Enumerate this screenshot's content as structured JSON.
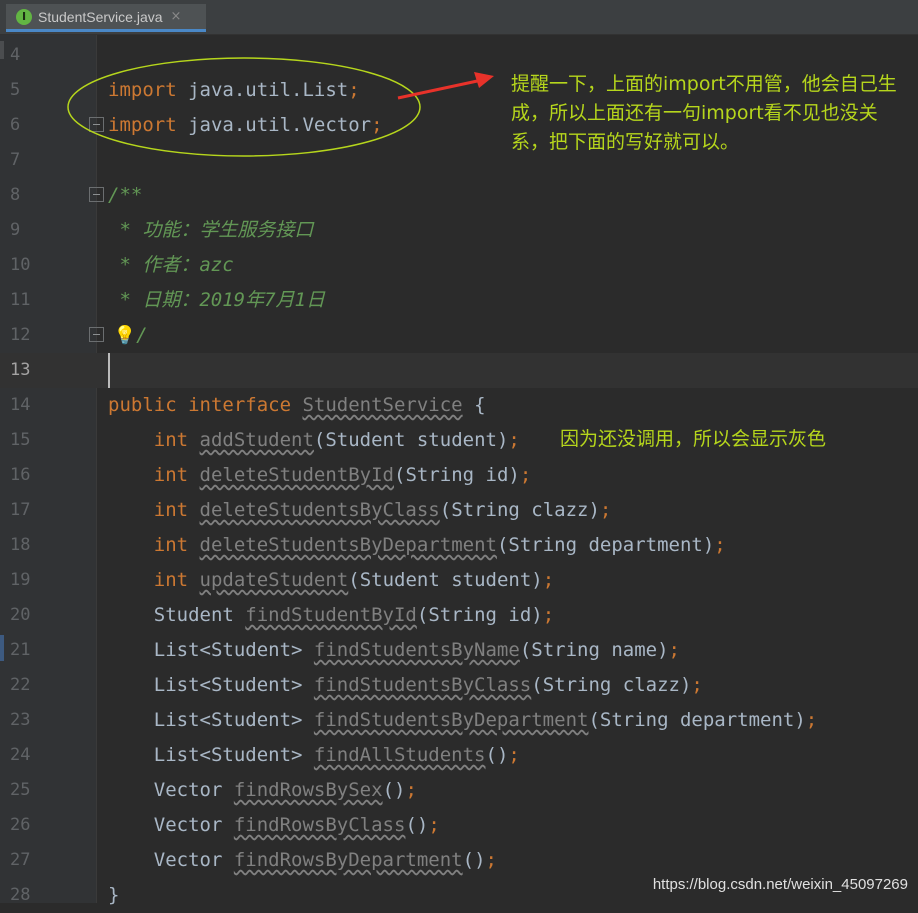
{
  "tab": {
    "filename": "StudentService.java",
    "icon": "I",
    "close": "×"
  },
  "editor": {
    "lines": [
      {
        "num": "4",
        "segments": []
      },
      {
        "num": "5",
        "segments": [
          {
            "cls": "kw",
            "text": "import "
          },
          {
            "cls": "plain",
            "text": "java.util.List"
          },
          {
            "cls": "kw",
            "text": ";"
          }
        ]
      },
      {
        "num": "6",
        "fold": true,
        "segments": [
          {
            "cls": "kw",
            "text": "import "
          },
          {
            "cls": "plain",
            "text": "java.util.Vector"
          },
          {
            "cls": "kw",
            "text": ";"
          }
        ]
      },
      {
        "num": "7",
        "segments": []
      },
      {
        "num": "8",
        "fold": true,
        "segments": [
          {
            "cls": "cmt",
            "text": "/**"
          }
        ]
      },
      {
        "num": "9",
        "segments": [
          {
            "cls": "cmt",
            "text": " * 功能：学生服务接口"
          }
        ]
      },
      {
        "num": "10",
        "segments": [
          {
            "cls": "cmt",
            "text": " * 作者：azc"
          }
        ]
      },
      {
        "num": "11",
        "segments": [
          {
            "cls": "cmt",
            "text": " * 日期：2019年7月1日"
          }
        ]
      },
      {
        "num": "12",
        "fold": true,
        "segments": [
          {
            "cls": "cmt bulb",
            "text": " 💡"
          },
          {
            "cls": "cmt",
            "text": "/"
          }
        ]
      },
      {
        "num": "13",
        "current": true,
        "segments": []
      },
      {
        "num": "14",
        "segments": [
          {
            "cls": "kw",
            "text": "public interface "
          },
          {
            "cls": "unused",
            "text": "StudentService"
          },
          {
            "cls": "plain",
            "text": " {"
          }
        ]
      },
      {
        "num": "15",
        "segments": [
          {
            "cls": "plain",
            "text": "    "
          },
          {
            "cls": "kw",
            "text": "int "
          },
          {
            "cls": "unused",
            "text": "addStudent"
          },
          {
            "cls": "plain",
            "text": "(Student student)"
          },
          {
            "cls": "kw",
            "text": ";"
          }
        ]
      },
      {
        "num": "16",
        "segments": [
          {
            "cls": "plain",
            "text": "    "
          },
          {
            "cls": "kw",
            "text": "int "
          },
          {
            "cls": "unused",
            "text": "deleteStudentById"
          },
          {
            "cls": "plain",
            "text": "(String id)"
          },
          {
            "cls": "kw",
            "text": ";"
          }
        ]
      },
      {
        "num": "17",
        "segments": [
          {
            "cls": "plain",
            "text": "    "
          },
          {
            "cls": "kw",
            "text": "int "
          },
          {
            "cls": "unused",
            "text": "deleteStudentsByClass"
          },
          {
            "cls": "plain",
            "text": "(String clazz)"
          },
          {
            "cls": "kw",
            "text": ";"
          }
        ]
      },
      {
        "num": "18",
        "segments": [
          {
            "cls": "plain",
            "text": "    "
          },
          {
            "cls": "kw",
            "text": "int "
          },
          {
            "cls": "unused",
            "text": "deleteStudentsByDepartment"
          },
          {
            "cls": "plain",
            "text": "(String department)"
          },
          {
            "cls": "kw",
            "text": ";"
          }
        ]
      },
      {
        "num": "19",
        "segments": [
          {
            "cls": "plain",
            "text": "    "
          },
          {
            "cls": "kw",
            "text": "int "
          },
          {
            "cls": "unused",
            "text": "updateStudent"
          },
          {
            "cls": "plain",
            "text": "(Student student)"
          },
          {
            "cls": "kw",
            "text": ";"
          }
        ]
      },
      {
        "num": "20",
        "segments": [
          {
            "cls": "plain",
            "text": "    Student "
          },
          {
            "cls": "unused",
            "text": "findStudentById"
          },
          {
            "cls": "plain",
            "text": "(String id)"
          },
          {
            "cls": "kw",
            "text": ";"
          }
        ]
      },
      {
        "num": "21",
        "segments": [
          {
            "cls": "plain",
            "text": "    List<Student> "
          },
          {
            "cls": "unused",
            "text": "findStudentsByName"
          },
          {
            "cls": "plain",
            "text": "(String name)"
          },
          {
            "cls": "kw",
            "text": ";"
          }
        ]
      },
      {
        "num": "22",
        "segments": [
          {
            "cls": "plain",
            "text": "    List<Student> "
          },
          {
            "cls": "unused",
            "text": "findStudentsByClass"
          },
          {
            "cls": "plain",
            "text": "(String clazz)"
          },
          {
            "cls": "kw",
            "text": ";"
          }
        ]
      },
      {
        "num": "23",
        "segments": [
          {
            "cls": "plain",
            "text": "    List<Student> "
          },
          {
            "cls": "unused",
            "text": "findStudentsByDepartment"
          },
          {
            "cls": "plain",
            "text": "(String department)"
          },
          {
            "cls": "kw",
            "text": ";"
          }
        ]
      },
      {
        "num": "24",
        "segments": [
          {
            "cls": "plain",
            "text": "    List<Student> "
          },
          {
            "cls": "unused",
            "text": "findAllStudents"
          },
          {
            "cls": "plain",
            "text": "()"
          },
          {
            "cls": "kw",
            "text": ";"
          }
        ]
      },
      {
        "num": "25",
        "segments": [
          {
            "cls": "plain",
            "text": "    Vector "
          },
          {
            "cls": "unused",
            "text": "findRowsBySex"
          },
          {
            "cls": "plain",
            "text": "()"
          },
          {
            "cls": "kw",
            "text": ";"
          }
        ]
      },
      {
        "num": "26",
        "segments": [
          {
            "cls": "plain",
            "text": "    Vector "
          },
          {
            "cls": "unused",
            "text": "findRowsByClass"
          },
          {
            "cls": "plain",
            "text": "()"
          },
          {
            "cls": "kw",
            "text": ";"
          }
        ]
      },
      {
        "num": "27",
        "segments": [
          {
            "cls": "plain",
            "text": "    Vector "
          },
          {
            "cls": "unused",
            "text": "findRowsByDepartment"
          },
          {
            "cls": "plain",
            "text": "()"
          },
          {
            "cls": "kw",
            "text": ";"
          }
        ]
      },
      {
        "num": "28",
        "segments": [
          {
            "cls": "plain",
            "text": "}"
          }
        ]
      }
    ]
  },
  "annotations": {
    "import_note": "提醒一下，上面的import不用管，他会自己生成，所以上面还有一句import看不见也没关系，把下面的写好就可以。",
    "unused_note": "因为还没调用，所以会显示灰色"
  },
  "watermark": "https://blog.csdn.net/weixin_45097269",
  "colors": {
    "background": "#2b2b2b",
    "keyword": "#cc7832",
    "text": "#a9b7c6",
    "comment": "#629755",
    "unused": "#808080",
    "annotation": "#b6d61c",
    "marker": "#e8322a"
  }
}
